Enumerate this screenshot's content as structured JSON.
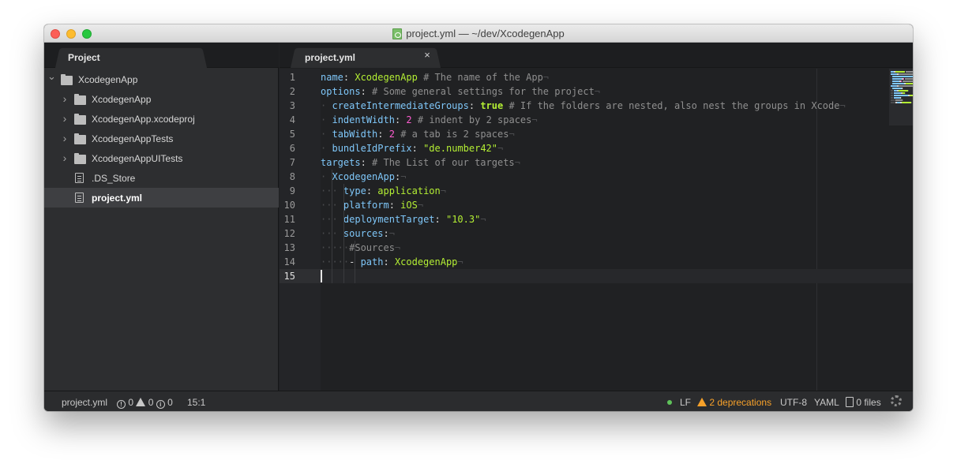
{
  "window": {
    "title": "project.yml — ~/dev/XcodegenApp"
  },
  "sidebar": {
    "tab_label": "Project",
    "tree": [
      {
        "label": "XcodegenApp",
        "kind": "folder",
        "level": 0,
        "expanded": true,
        "selected": false
      },
      {
        "label": "XcodegenApp",
        "kind": "folder",
        "level": 1,
        "expanded": false,
        "selected": false
      },
      {
        "label": "XcodegenApp.xcodeproj",
        "kind": "folder",
        "level": 1,
        "expanded": false,
        "selected": false
      },
      {
        "label": "XcodegenAppTests",
        "kind": "folder",
        "level": 1,
        "expanded": false,
        "selected": false
      },
      {
        "label": "XcodegenAppUITests",
        "kind": "folder",
        "level": 1,
        "expanded": false,
        "selected": false
      },
      {
        "label": ".DS_Store",
        "kind": "file",
        "level": 1,
        "selected": false
      },
      {
        "label": "project.yml",
        "kind": "file",
        "level": 1,
        "selected": true
      }
    ]
  },
  "editor": {
    "tab_label": "project.yml",
    "close_glyph": "×",
    "active_line": 15,
    "lines": [
      {
        "n": "1",
        "segs": [
          [
            "k",
            "name"
          ],
          [
            "t",
            ": "
          ],
          [
            "s",
            "XcodegenApp"
          ],
          [
            "t",
            " "
          ],
          [
            "c",
            "# The name of the App"
          ],
          [
            "i",
            "¬"
          ]
        ]
      },
      {
        "n": "2",
        "segs": [
          [
            "k",
            "options"
          ],
          [
            "t",
            ": "
          ],
          [
            "c",
            "# Some general settings for the project"
          ],
          [
            "i",
            "¬"
          ]
        ]
      },
      {
        "n": "3",
        "segs": [
          [
            "i",
            "·"
          ],
          [
            "t",
            " "
          ],
          [
            "k",
            "createIntermediateGroups"
          ],
          [
            "t",
            ": "
          ],
          [
            "b",
            "true"
          ],
          [
            "t",
            " "
          ],
          [
            "c",
            "# If the folders are nested, also nest the groups in Xcode"
          ],
          [
            "i",
            "¬"
          ]
        ]
      },
      {
        "n": "4",
        "segs": [
          [
            "i",
            "·"
          ],
          [
            "t",
            " "
          ],
          [
            "k",
            "indentWidth"
          ],
          [
            "t",
            ": "
          ],
          [
            "n",
            "2"
          ],
          [
            "t",
            " "
          ],
          [
            "c",
            "# indent by 2 spaces"
          ],
          [
            "i",
            "¬"
          ]
        ]
      },
      {
        "n": "5",
        "segs": [
          [
            "i",
            "·"
          ],
          [
            "t",
            " "
          ],
          [
            "k",
            "tabWidth"
          ],
          [
            "t",
            ": "
          ],
          [
            "n",
            "2"
          ],
          [
            "t",
            " "
          ],
          [
            "c",
            "# a tab is 2 spaces"
          ],
          [
            "i",
            "¬"
          ]
        ]
      },
      {
        "n": "6",
        "segs": [
          [
            "i",
            "·"
          ],
          [
            "t",
            " "
          ],
          [
            "k",
            "bundleIdPrefix"
          ],
          [
            "t",
            ": "
          ],
          [
            "s",
            "\"de.number42\""
          ],
          [
            "i",
            "¬"
          ]
        ]
      },
      {
        "n": "7",
        "segs": [
          [
            "k",
            "targets"
          ],
          [
            "t",
            ": "
          ],
          [
            "c",
            "# The List of our targets"
          ],
          [
            "i",
            "¬"
          ]
        ]
      },
      {
        "n": "8",
        "segs": [
          [
            "i",
            "·"
          ],
          [
            "t",
            " "
          ],
          [
            "k",
            "XcodegenApp"
          ],
          [
            "t",
            ":"
          ],
          [
            "i",
            "¬"
          ]
        ]
      },
      {
        "n": "9",
        "segs": [
          [
            "i",
            "···"
          ],
          [
            "t",
            " "
          ],
          [
            "k",
            "type"
          ],
          [
            "t",
            ": "
          ],
          [
            "s",
            "application"
          ],
          [
            "i",
            "¬"
          ]
        ]
      },
      {
        "n": "10",
        "segs": [
          [
            "i",
            "···"
          ],
          [
            "t",
            " "
          ],
          [
            "k",
            "platform"
          ],
          [
            "t",
            ": "
          ],
          [
            "s",
            "iOS"
          ],
          [
            "i",
            "¬"
          ]
        ]
      },
      {
        "n": "11",
        "segs": [
          [
            "i",
            "···"
          ],
          [
            "t",
            " "
          ],
          [
            "k",
            "deploymentTarget"
          ],
          [
            "t",
            ": "
          ],
          [
            "s",
            "\"10.3\""
          ],
          [
            "i",
            "¬"
          ]
        ]
      },
      {
        "n": "12",
        "segs": [
          [
            "i",
            "···"
          ],
          [
            "t",
            " "
          ],
          [
            "k",
            "sources"
          ],
          [
            "t",
            ":"
          ],
          [
            "i",
            "¬"
          ]
        ]
      },
      {
        "n": "13",
        "segs": [
          [
            "i",
            "·····"
          ],
          [
            "c",
            "#Sources"
          ],
          [
            "i",
            "¬"
          ]
        ]
      },
      {
        "n": "14",
        "segs": [
          [
            "i",
            "·····"
          ],
          [
            "t",
            "- "
          ],
          [
            "k",
            "path"
          ],
          [
            "t",
            ": "
          ],
          [
            "s",
            "XcodegenApp"
          ],
          [
            "i",
            "¬"
          ]
        ]
      },
      {
        "n": "15",
        "segs": []
      }
    ]
  },
  "statusbar": {
    "filename": "project.yml",
    "errors": "0",
    "warnings": "0",
    "infos": "0",
    "cursor_pos": "15:1",
    "line_ending": "LF",
    "deprecations": "2 deprecations",
    "encoding": "UTF-8",
    "grammar": "YAML",
    "files": "0 files"
  },
  "colors": {
    "key": "#7fc7f9",
    "string": "#b4ef34",
    "comment": "#8f8f8f",
    "number": "#ff5dd1",
    "warning": "#f7a12a"
  }
}
